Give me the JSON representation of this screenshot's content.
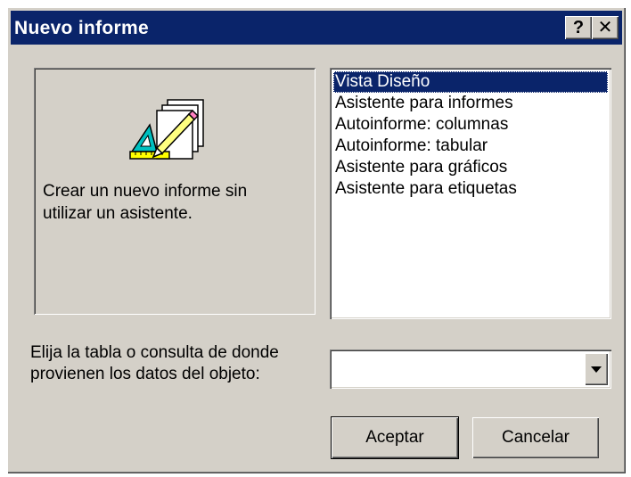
{
  "window": {
    "title": "Nuevo informe",
    "help_label": "?",
    "close_label": "✕"
  },
  "preview": {
    "icon": "report-design-icon",
    "description": "Crear un nuevo informe sin\nutilizar un asistente."
  },
  "report_types": {
    "selected_index": 0,
    "items": [
      {
        "label": "Vista Diseño"
      },
      {
        "label": "Asistente para informes"
      },
      {
        "label": "Autoinforme: columnas"
      },
      {
        "label": "Autoinforme: tabular"
      },
      {
        "label": "Asistente para gráficos"
      },
      {
        "label": "Asistente para etiquetas"
      }
    ]
  },
  "source": {
    "label": "Elija la tabla o consulta de donde provienen los datos del objeto:",
    "value": ""
  },
  "buttons": {
    "ok_label": "Aceptar",
    "cancel_label": "Cancelar"
  },
  "colors": {
    "titlebar": "#0a246a",
    "face": "#d4d0c8",
    "selection": "#0a246a"
  }
}
